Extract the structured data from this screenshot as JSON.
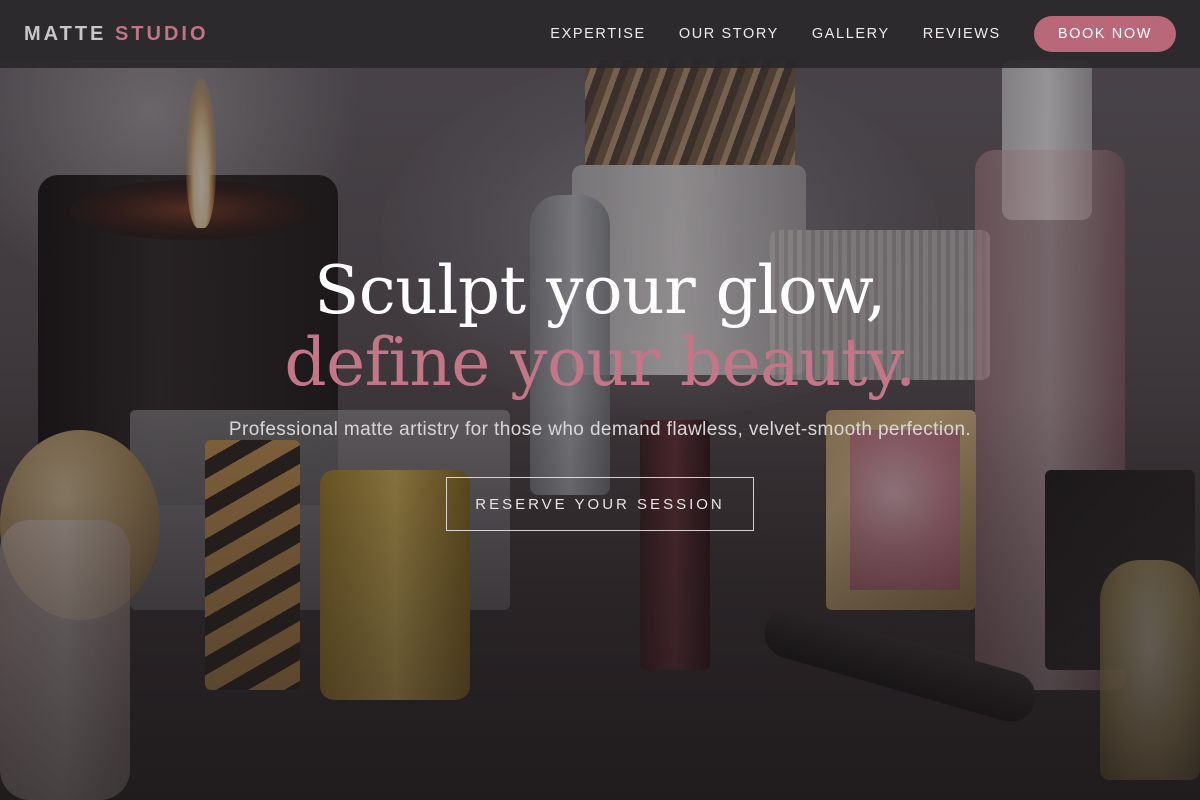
{
  "brand": {
    "name_part1": "MATTE",
    "name_part2": "STUDIO",
    "accent_color": "#c07484"
  },
  "nav": {
    "links": [
      {
        "label": "EXPERTISE"
      },
      {
        "label": "OUR STORY"
      },
      {
        "label": "GALLERY"
      },
      {
        "label": "REVIEWS"
      }
    ],
    "cta_label": "BOOK NOW"
  },
  "hero": {
    "headline_line1": "Sculpt your glow,",
    "headline_line2": "define your beauty.",
    "subtitle": "Professional matte artistry for those who demand flawless, velvet-smooth perfection.",
    "cta_label": "RESERVE YOUR SESSION",
    "background_image": "cosmetics-still-life-with-candle"
  }
}
